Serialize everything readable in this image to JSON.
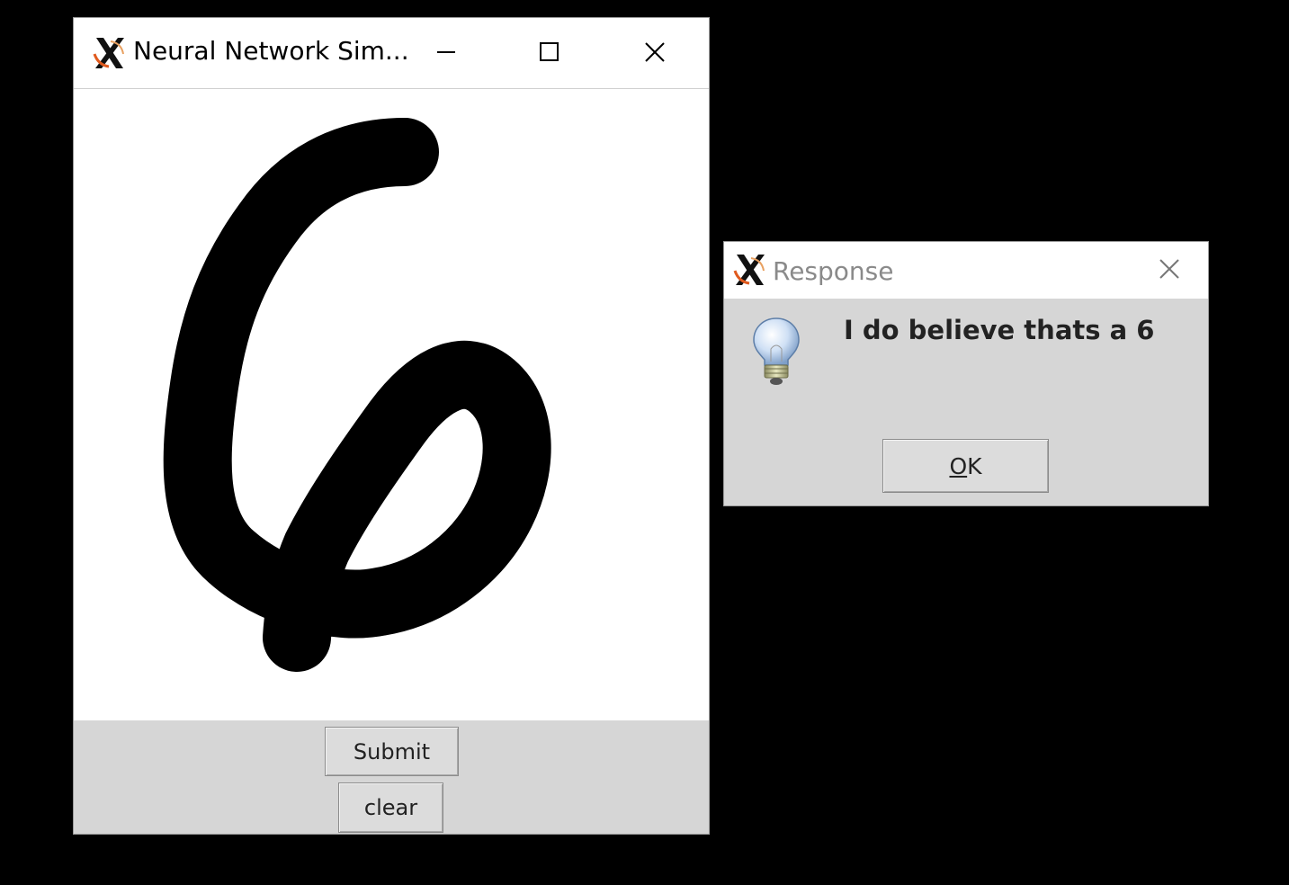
{
  "main_window": {
    "title": "Neural Network Sim...",
    "controls": {
      "minimize": "minimize-icon",
      "maximize": "maximize-icon",
      "close": "close-icon"
    },
    "canvas": {
      "drawn_content": "handwritten digit"
    },
    "buttons": {
      "submit": "Submit",
      "clear": "clear"
    }
  },
  "dialog": {
    "title": "Response",
    "icon": "lightbulb-icon",
    "message": "I do believe thats a 6",
    "ok": {
      "mnemonic": "O",
      "rest": "K"
    }
  },
  "colors": {
    "desktop": "#000000",
    "panel": "#d6d6d6",
    "title_inactive": "#8a8a8a",
    "stroke": "#000000"
  }
}
